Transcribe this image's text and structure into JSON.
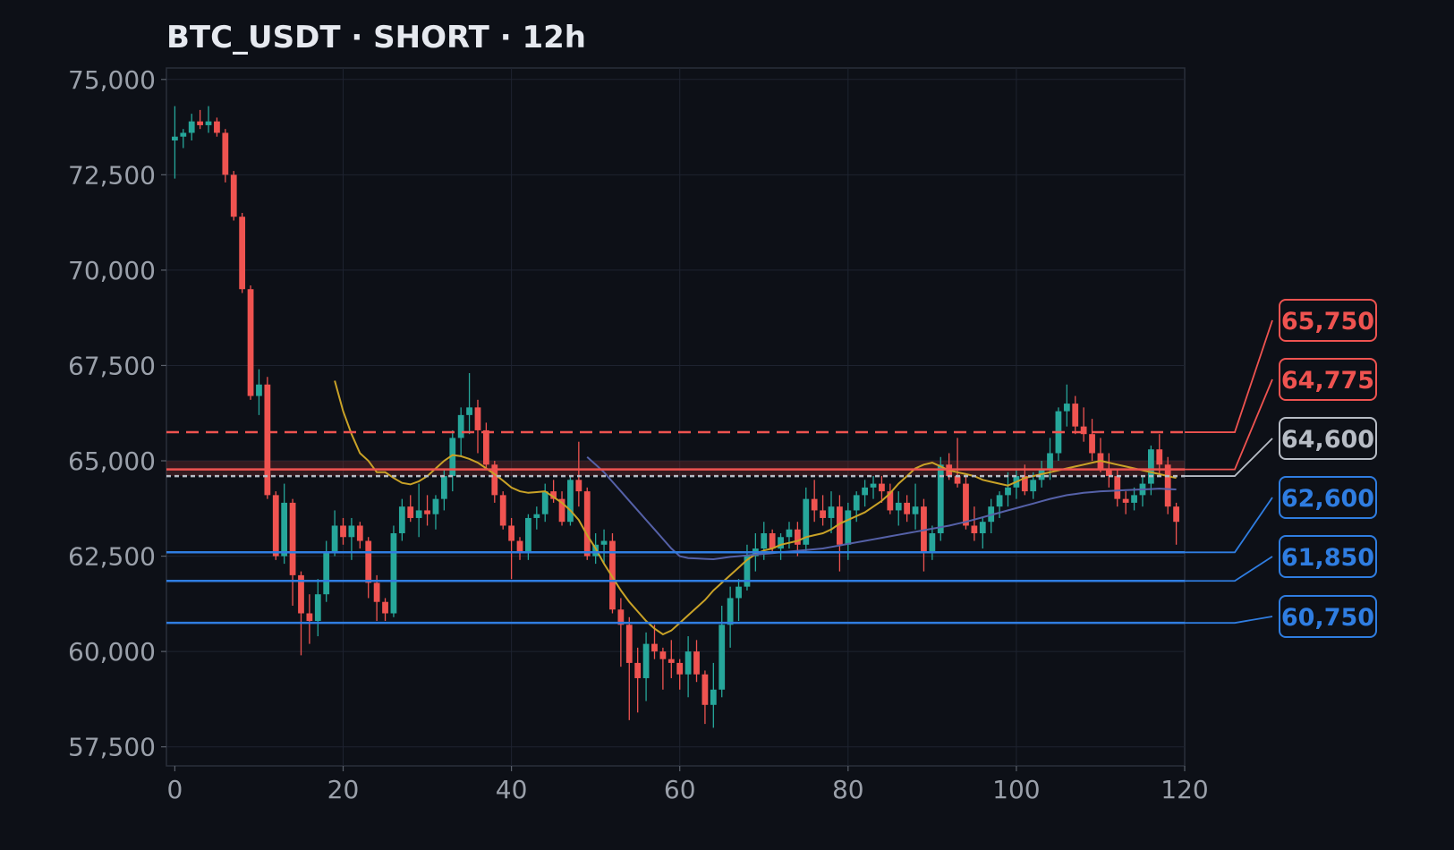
{
  "chart_data": {
    "type": "candlestick",
    "title": "BTC_USDT · SHORT · 12h",
    "xlabel": "",
    "ylabel": "",
    "xlim": [
      -1,
      120
    ],
    "ylim": [
      57000,
      75300
    ],
    "x_ticks": [
      0,
      20,
      40,
      60,
      80,
      100,
      120
    ],
    "y_ticks": [
      57500,
      60000,
      62500,
      65000,
      67500,
      70000,
      72500,
      75000
    ],
    "y_tick_labels": [
      "57,500",
      "60,000",
      "62,500",
      "65,000",
      "67,500",
      "70,000",
      "72,500",
      "75,000"
    ],
    "x_tick_labels": [
      "0",
      "20",
      "40",
      "60",
      "80",
      "100",
      "120"
    ],
    "grid": true,
    "colors": {
      "background": "#0d1017",
      "up": "#26a69a",
      "down": "#ef5350",
      "grid": "#1e2330",
      "axis_text": "#9aa0aa",
      "title": "#e6e9ef",
      "ma_fast": "#c9a227",
      "ma_slow": "#5561a8",
      "entry": "#ef5350",
      "current": "#b7bcc5",
      "target": "#2f7de1"
    },
    "candles": [
      [
        73400,
        74300,
        72400,
        73500
      ],
      [
        73500,
        73700,
        73200,
        73600
      ],
      [
        73600,
        74100,
        73400,
        73900
      ],
      [
        73900,
        74200,
        73700,
        73800
      ],
      [
        73800,
        74300,
        73600,
        73900
      ],
      [
        73900,
        74000,
        73500,
        73600
      ],
      [
        73600,
        73700,
        72300,
        72500
      ],
      [
        72500,
        72600,
        71300,
        71400
      ],
      [
        71400,
        71500,
        69400,
        69500
      ],
      [
        69500,
        69600,
        66600,
        66700
      ],
      [
        66700,
        67400,
        66200,
        67000
      ],
      [
        67000,
        67200,
        64000,
        64100
      ],
      [
        64100,
        64200,
        62400,
        62500
      ],
      [
        62500,
        64400,
        62300,
        63900
      ],
      [
        63900,
        64000,
        61200,
        62000
      ],
      [
        62000,
        62100,
        59900,
        61000
      ],
      [
        61000,
        61500,
        60200,
        60800
      ],
      [
        60800,
        61900,
        60400,
        61500
      ],
      [
        61500,
        62900,
        61300,
        62600
      ],
      [
        62600,
        63700,
        62500,
        63300
      ],
      [
        63300,
        63500,
        62800,
        63000
      ],
      [
        63000,
        63500,
        62400,
        63300
      ],
      [
        63300,
        63400,
        62700,
        62900
      ],
      [
        62900,
        63000,
        61400,
        61800
      ],
      [
        61800,
        62000,
        60800,
        61300
      ],
      [
        61300,
        61400,
        60800,
        61000
      ],
      [
        61000,
        63300,
        60900,
        63100
      ],
      [
        63100,
        64000,
        62900,
        63800
      ],
      [
        63800,
        64100,
        63400,
        63500
      ],
      [
        63500,
        64400,
        63000,
        63700
      ],
      [
        63700,
        64100,
        63300,
        63600
      ],
      [
        63600,
        64100,
        63200,
        64000
      ],
      [
        64000,
        64800,
        63700,
        64600
      ],
      [
        64600,
        65800,
        64200,
        65600
      ],
      [
        65600,
        66400,
        65100,
        66200
      ],
      [
        66200,
        67300,
        65700,
        66400
      ],
      [
        66400,
        66600,
        65200,
        65800
      ],
      [
        65800,
        66000,
        64800,
        64900
      ],
      [
        64900,
        65000,
        63900,
        64100
      ],
      [
        64100,
        64200,
        63200,
        63300
      ],
      [
        63300,
        63500,
        61900,
        62900
      ],
      [
        62900,
        63000,
        62400,
        62600
      ],
      [
        62600,
        63600,
        62400,
        63500
      ],
      [
        63500,
        63800,
        63200,
        63600
      ],
      [
        63600,
        64400,
        63400,
        64200
      ],
      [
        64200,
        64500,
        63900,
        64000
      ],
      [
        64000,
        64200,
        63300,
        63400
      ],
      [
        63400,
        64600,
        63300,
        64500
      ],
      [
        64500,
        65500,
        63800,
        64200
      ],
      [
        64200,
        64300,
        62400,
        62500
      ],
      [
        62500,
        63100,
        62300,
        62800
      ],
      [
        62800,
        63200,
        62300,
        62900
      ],
      [
        62900,
        63100,
        61000,
        61100
      ],
      [
        61100,
        61400,
        59600,
        60700
      ],
      [
        60700,
        60900,
        58200,
        59700
      ],
      [
        59700,
        60100,
        58400,
        59300
      ],
      [
        59300,
        60500,
        58700,
        60200
      ],
      [
        60200,
        60700,
        59800,
        60000
      ],
      [
        60000,
        60100,
        59000,
        59800
      ],
      [
        59800,
        60300,
        59300,
        59700
      ],
      [
        59700,
        59800,
        59000,
        59400
      ],
      [
        59400,
        60400,
        58800,
        60000
      ],
      [
        60000,
        60300,
        59200,
        59400
      ],
      [
        59400,
        59500,
        58100,
        58600
      ],
      [
        58600,
        59700,
        58000,
        59000
      ],
      [
        59000,
        61200,
        58800,
        60700
      ],
      [
        60700,
        61700,
        60100,
        61400
      ],
      [
        61400,
        61900,
        60800,
        61700
      ],
      [
        61700,
        62800,
        61600,
        62500
      ],
      [
        62500,
        63100,
        62100,
        62700
      ],
      [
        62700,
        63400,
        62400,
        63100
      ],
      [
        63100,
        63200,
        62600,
        62700
      ],
      [
        62700,
        63100,
        62400,
        63000
      ],
      [
        63000,
        63400,
        62700,
        63200
      ],
      [
        63200,
        63400,
        62500,
        62800
      ],
      [
        62800,
        64300,
        62600,
        64000
      ],
      [
        64000,
        64500,
        63400,
        63700
      ],
      [
        63700,
        64100,
        63300,
        63500
      ],
      [
        63500,
        64200,
        63100,
        63800
      ],
      [
        63800,
        64100,
        62100,
        62800
      ],
      [
        62800,
        63900,
        62400,
        63700
      ],
      [
        63700,
        64200,
        63400,
        64100
      ],
      [
        64100,
        64500,
        63800,
        64300
      ],
      [
        64300,
        64600,
        64000,
        64400
      ],
      [
        64400,
        64600,
        63900,
        64200
      ],
      [
        64200,
        64400,
        63600,
        63700
      ],
      [
        63700,
        64200,
        63300,
        63900
      ],
      [
        63900,
        64100,
        63400,
        63600
      ],
      [
        63600,
        64400,
        63200,
        63800
      ],
      [
        63800,
        64000,
        62100,
        62600
      ],
      [
        62600,
        63300,
        62400,
        63100
      ],
      [
        63100,
        65100,
        62900,
        64900
      ],
      [
        64900,
        65200,
        64500,
        64600
      ],
      [
        64600,
        65600,
        64300,
        64400
      ],
      [
        64400,
        64600,
        63200,
        63300
      ],
      [
        63300,
        63800,
        62900,
        63100
      ],
      [
        63100,
        63500,
        62700,
        63400
      ],
      [
        63400,
        64000,
        63100,
        63800
      ],
      [
        63800,
        64200,
        63500,
        64100
      ],
      [
        64100,
        64700,
        63800,
        64300
      ],
      [
        64300,
        64800,
        64000,
        64600
      ],
      [
        64600,
        64900,
        64100,
        64200
      ],
      [
        64200,
        64700,
        64000,
        64500
      ],
      [
        64500,
        65000,
        64300,
        64800
      ],
      [
        64800,
        65600,
        64500,
        65200
      ],
      [
        65200,
        66400,
        65000,
        66300
      ],
      [
        66300,
        67000,
        65900,
        66500
      ],
      [
        66500,
        66700,
        65700,
        65900
      ],
      [
        65900,
        66400,
        65500,
        65700
      ],
      [
        65700,
        66100,
        65000,
        65200
      ],
      [
        65200,
        65600,
        64700,
        64800
      ],
      [
        64800,
        65200,
        64300,
        64600
      ],
      [
        64600,
        64800,
        63800,
        64000
      ],
      [
        64000,
        64200,
        63600,
        63900
      ],
      [
        63900,
        64300,
        63700,
        64100
      ],
      [
        64100,
        64600,
        63800,
        64400
      ],
      [
        64400,
        65400,
        64100,
        65300
      ],
      [
        65300,
        65700,
        64600,
        64900
      ],
      [
        64900,
        65100,
        63600,
        63800
      ],
      [
        63800,
        63900,
        62800,
        63400
      ]
    ],
    "moving_averages": [
      {
        "start": 19,
        "values": [
          67100,
          66300,
          65700,
          65200,
          65000,
          64700,
          64700,
          64550,
          64420,
          64380,
          64460,
          64600,
          64800,
          65000,
          65150,
          65120,
          65050,
          64950,
          64800,
          64650,
          64480,
          64300,
          64200,
          64160,
          64180,
          64200,
          64050,
          63900,
          63700,
          63450,
          63050,
          62700,
          62300,
          61950,
          61600,
          61300,
          61050,
          60800,
          60600,
          60450,
          60550,
          60750,
          60950,
          61150,
          61350,
          61600,
          61800,
          62000,
          62200,
          62400,
          62550,
          62650,
          62700,
          62800,
          62850,
          62900,
          63000,
          63050,
          63100,
          63200,
          63350,
          63450,
          63550,
          63650,
          63800,
          63950,
          64150,
          64400,
          64600,
          64800,
          64900,
          64950,
          64850,
          64750,
          64700,
          64650,
          64600,
          64500,
          64450,
          64400,
          64350,
          64450,
          64550,
          64600,
          64650,
          64700,
          64750,
          64800,
          64850,
          64900,
          64950,
          65000,
          64950,
          64900,
          64850,
          64800,
          64750,
          64700,
          64650,
          64600,
          64550
        ]
      },
      {
        "start": 49,
        "values": [
          65100,
          64900,
          64700,
          64450,
          64200,
          63950,
          63700,
          63450,
          63200,
          62950,
          62700,
          62500,
          62450,
          62440,
          62430,
          62420,
          62450,
          62480,
          62500,
          62520,
          62540,
          62560,
          62580,
          62600,
          62620,
          62640,
          62660,
          62680,
          62700,
          62740,
          62780,
          62820,
          62860,
          62900,
          62940,
          62980,
          63020,
          63060,
          63100,
          63140,
          63180,
          63220,
          63260,
          63300,
          63350,
          63400,
          63460,
          63520,
          63580,
          63640,
          63700,
          63760,
          63820,
          63880,
          63940,
          64000,
          64050,
          64100,
          64130,
          64160,
          64180,
          64200,
          64210,
          64220,
          64230,
          64240,
          64250,
          64260,
          64270,
          64260,
          64250
        ]
      }
    ],
    "levels": [
      {
        "price": 65750,
        "label": "65,750",
        "role": "stop",
        "style": "dashed"
      },
      {
        "price": 64775,
        "label": "64,775",
        "role": "entry",
        "style": "solid"
      },
      {
        "price": 64600,
        "label": "64,600",
        "role": "current",
        "style": "dotted"
      },
      {
        "price": 62600,
        "label": "62,600",
        "role": "target",
        "style": "solid"
      },
      {
        "price": 61850,
        "label": "61,850",
        "role": "target",
        "style": "solid"
      },
      {
        "price": 60750,
        "label": "60,750",
        "role": "target",
        "style": "solid"
      }
    ],
    "entry_zone": [
      64600,
      65000
    ]
  }
}
